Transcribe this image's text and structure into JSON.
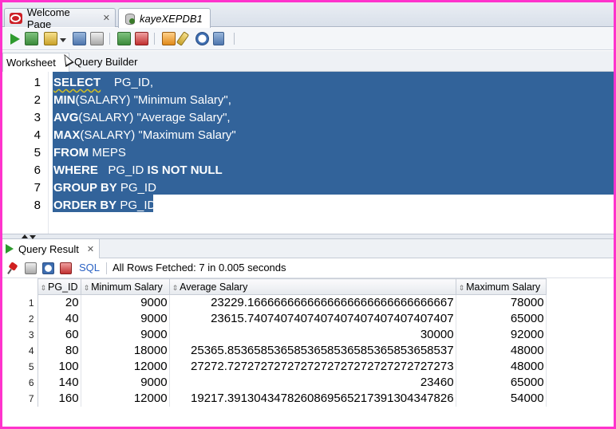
{
  "tabs": [
    {
      "label": "Welcome Page",
      "icon": "oracle-icon"
    },
    {
      "label": "kayeXEPDB1",
      "icon": "database-connection-icon"
    }
  ],
  "worksheet_tabs": [
    "Worksheet",
    "Query Builder"
  ],
  "editor": {
    "line_numbers": [
      "1",
      "2",
      "3",
      "4",
      "5",
      "6",
      "7",
      "8"
    ],
    "lines": [
      [
        {
          "t": "SELECT",
          "kw": true,
          "sq": true
        },
        {
          "t": "    PG_ID,"
        }
      ],
      [
        {
          "t": "MIN",
          "kw": true
        },
        {
          "t": "(SALARY) \"Minimum Salary\","
        }
      ],
      [
        {
          "t": "AVG",
          "kw": true
        },
        {
          "t": "(SALARY) \"Average Salary\","
        }
      ],
      [
        {
          "t": "MAX",
          "kw": true
        },
        {
          "t": "(SALARY) \"Maximum Salary\""
        }
      ],
      [
        {
          "t": "FROM",
          "kw": true
        },
        {
          "t": " MEPS"
        }
      ],
      [
        {
          "t": "WHERE",
          "kw": true
        },
        {
          "t": "   PG_ID "
        },
        {
          "t": "IS NOT NULL",
          "kw": true
        }
      ],
      [
        {
          "t": "GROUP BY",
          "kw": true
        },
        {
          "t": " PG_ID"
        }
      ],
      [
        {
          "t": "ORDER BY",
          "kw": true
        },
        {
          "t": " PG_ID;"
        }
      ]
    ]
  },
  "result": {
    "tab_label": "Query Result",
    "sql_link": "SQL",
    "status": "All Rows Fetched: 7 in 0.005 seconds",
    "columns": [
      "PG_ID",
      "Minimum Salary",
      "Average Salary",
      "Maximum Salary"
    ],
    "rows": [
      {
        "n": "1",
        "pg": "20",
        "min": "9000",
        "avg": "23229.1666666666666666666666666666667",
        "max": "78000"
      },
      {
        "n": "2",
        "pg": "40",
        "min": "9000",
        "avg": "23615.7407407407407407407407407407407",
        "max": "65000"
      },
      {
        "n": "3",
        "pg": "60",
        "min": "9000",
        "avg": "30000",
        "max": "92000"
      },
      {
        "n": "4",
        "pg": "80",
        "min": "18000",
        "avg": "25365.8536585365853658536585365853658537",
        "max": "48000"
      },
      {
        "n": "5",
        "pg": "100",
        "min": "12000",
        "avg": "27272.7272727272727272727272727272727273",
        "max": "48000"
      },
      {
        "n": "6",
        "pg": "140",
        "min": "9000",
        "avg": "23460",
        "max": "65000"
      },
      {
        "n": "7",
        "pg": "160",
        "min": "12000",
        "avg": "19217.3913043478260869565217391304347826",
        "max": "54000"
      }
    ]
  },
  "colors": {
    "selection": "#32639a",
    "frame_border": "#ff33cc",
    "run_green": "#2e9a2e",
    "sql_link": "#2a62c4"
  }
}
